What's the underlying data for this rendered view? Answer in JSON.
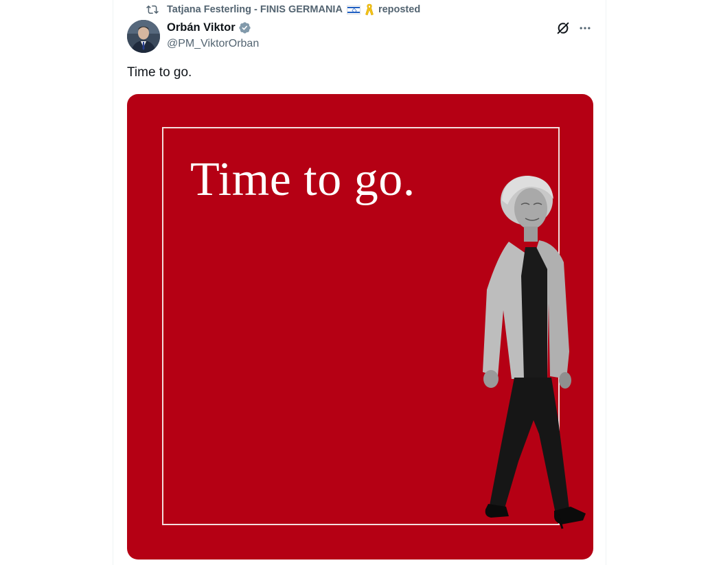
{
  "repost": {
    "reposter_name": "Tatjana Festerling - FINIS GERMANIA",
    "suffix": "reposted"
  },
  "author": {
    "display_name": "Orbán Viktor",
    "handle": "@PM_ViktorOrban",
    "verified": true
  },
  "tweet": {
    "text": "Time to go."
  },
  "media": {
    "headline": "Time to go.",
    "background_color": "#b50014"
  },
  "icons": {
    "repost": "repost-icon",
    "verified": "verified-badge-icon",
    "grok": "grok-icon",
    "more": "more-options-icon"
  },
  "colors": {
    "text_primary": "#0f1419",
    "text_secondary": "#536471",
    "verified_badge": "#829aab"
  }
}
